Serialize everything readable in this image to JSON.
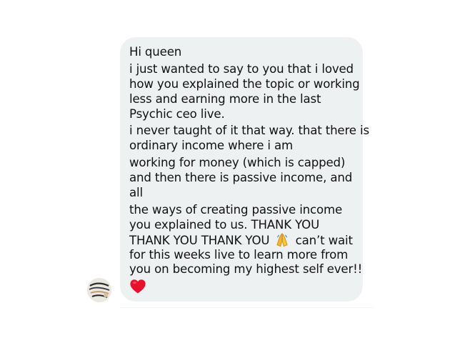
{
  "message": {
    "paragraphs": [
      [
        "Hi queen"
      ],
      [
        "i just wanted to say to you that i loved",
        "how you explained the topic or working",
        "less and earning more in the last",
        "Psychic ceo live."
      ],
      [
        "i never taught of it that way. that there is",
        "ordinary income where i am"
      ],
      [
        "working for money (which is capped)",
        "and then there is passive income, and",
        "all"
      ],
      [
        "the ways of creating passive income",
        "you explained to us. THANK YOU"
      ]
    ],
    "thank_line_before_emoji": "THANK YOU THANK YOU",
    "thank_line_after_emoji": "can’t wait",
    "closing_lines": [
      "for this weeks live to learn more from",
      "you on becoming my highest self ever!!"
    ],
    "inline_emoji": "folded-hands-emoji",
    "trailing_emoji": "red-heart-emoji"
  },
  "colors": {
    "bubble_background": "#eef1f2",
    "text": "#111111",
    "heart": "#e8112d",
    "hands": "#f5b728"
  },
  "avatar": {
    "icon": "avatar"
  }
}
